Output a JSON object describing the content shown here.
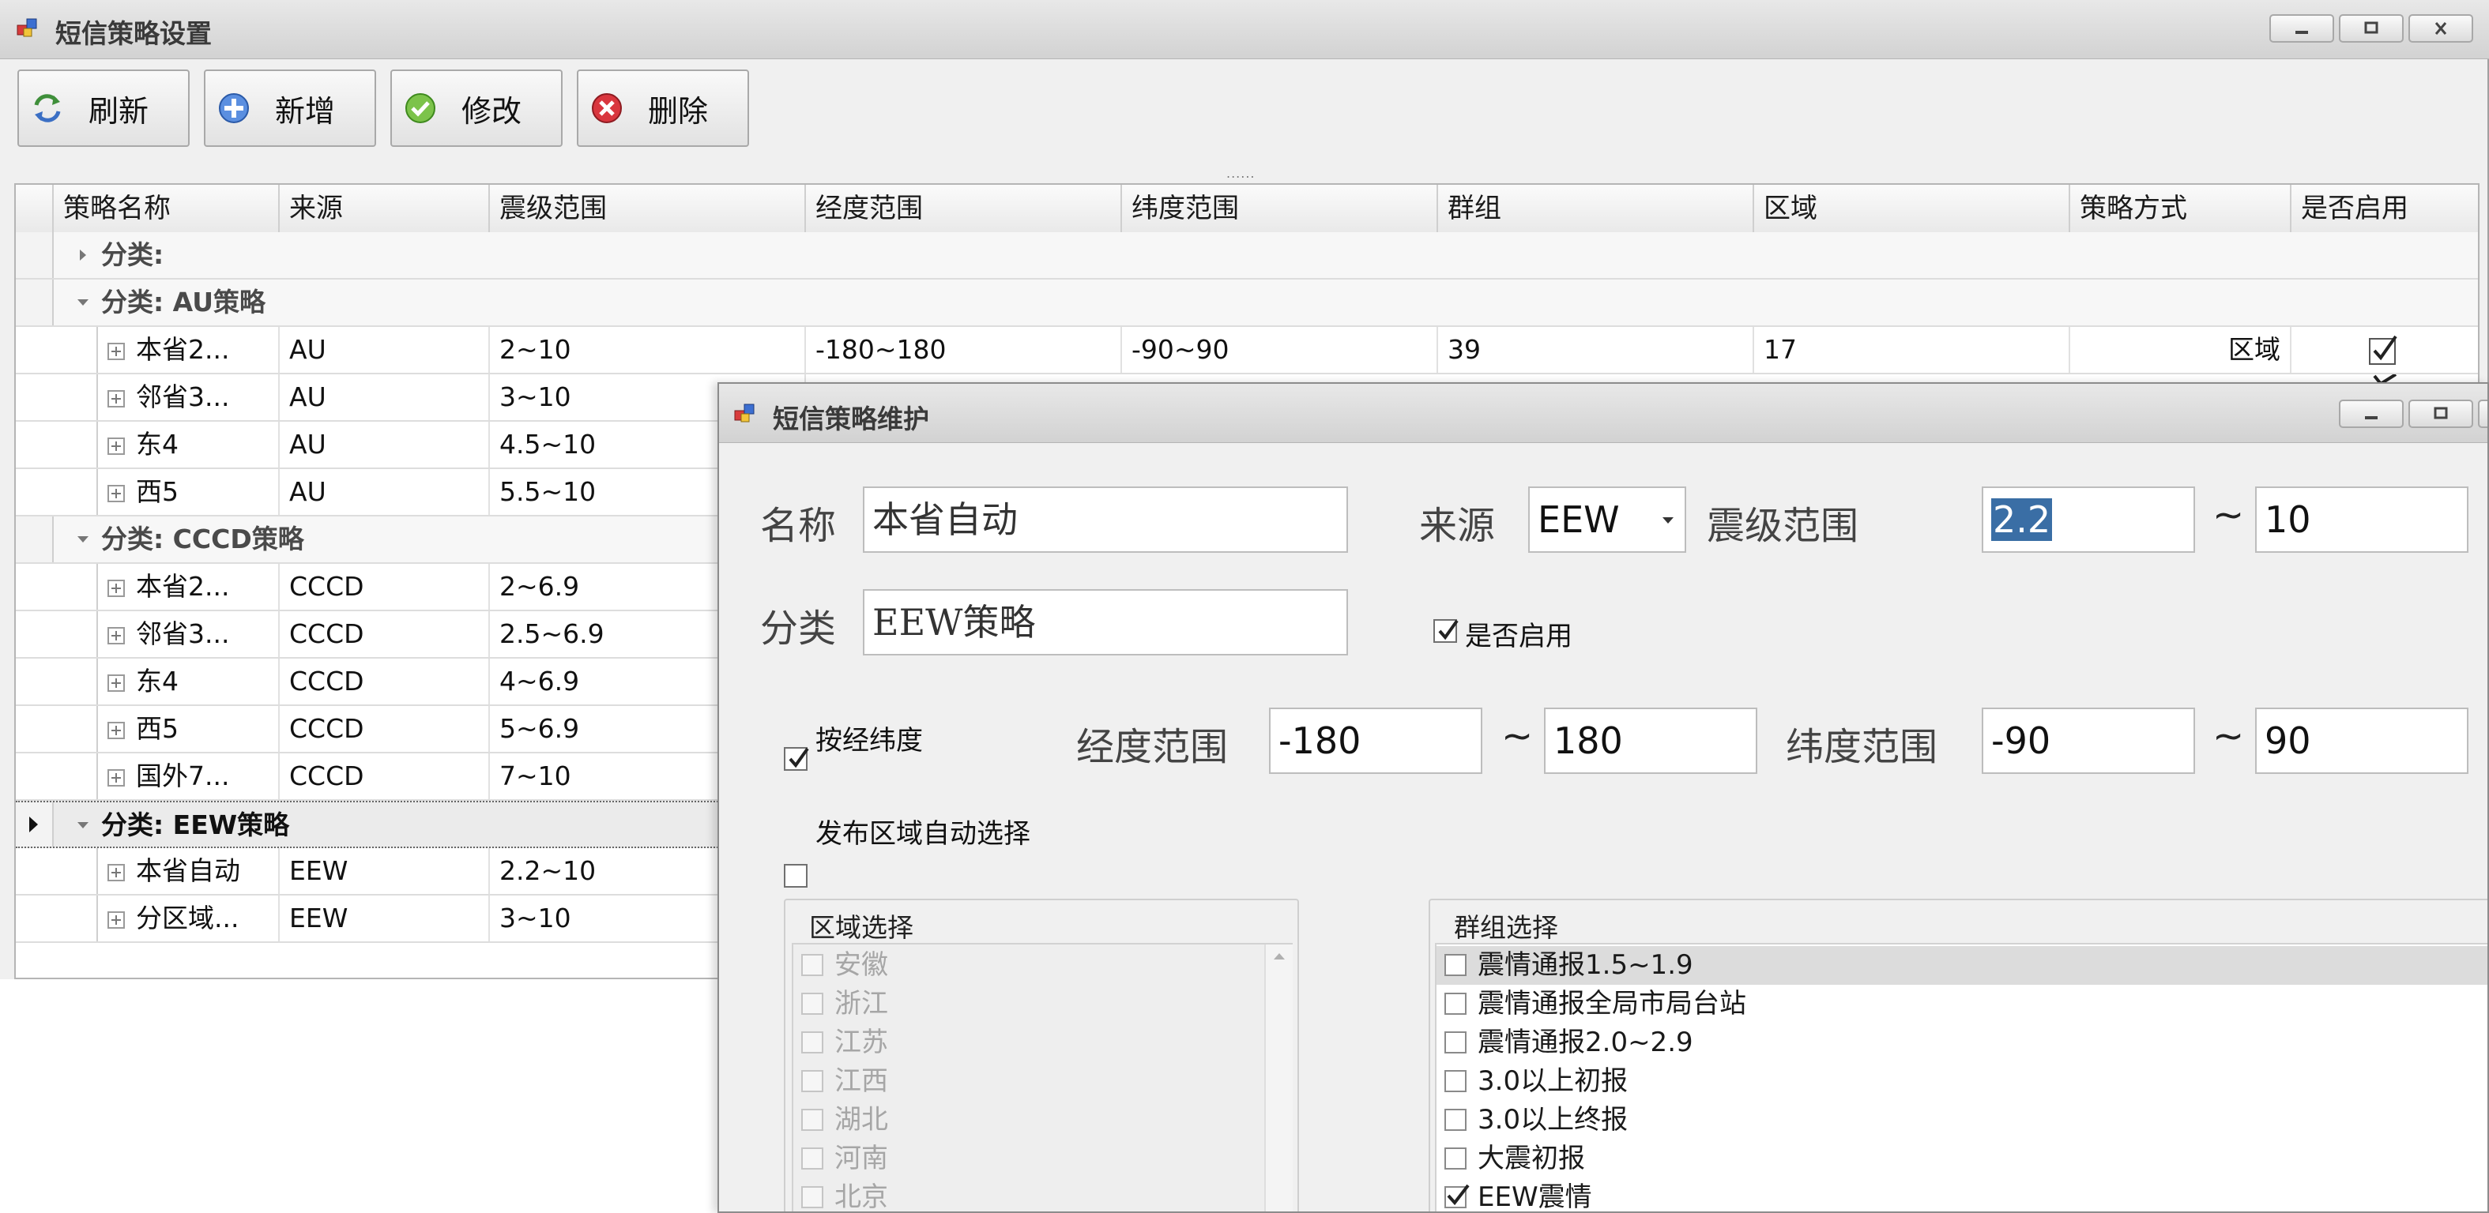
{
  "main": {
    "title": "短信策略设置",
    "toolbar": [
      {
        "label": "刷新",
        "icon": "refresh-icon"
      },
      {
        "label": "新增",
        "icon": "add-icon"
      },
      {
        "label": "修改",
        "icon": "edit-icon"
      },
      {
        "label": "删除",
        "icon": "delete-icon"
      }
    ],
    "splitter_grip": "......",
    "columns": [
      "策略名称",
      "来源",
      "震级范围",
      "经度范围",
      "纬度范围",
      "群组",
      "区域",
      "策略方式",
      "是否启用"
    ],
    "groups": [
      {
        "label": "分类:",
        "expanded": false,
        "rows": []
      },
      {
        "label": "分类: AU策略",
        "expanded": true,
        "rows": [
          {
            "name": "本省2...",
            "source": "AU",
            "magnitude": "2~10",
            "longitude": "-180~180",
            "latitude": "-90~90",
            "group": "39",
            "region": "17",
            "mode": "区域",
            "enabled": true
          },
          {
            "name": "邻省3...",
            "source": "AU",
            "magnitude": "3~10",
            "longitude": "",
            "latitude": "",
            "group": "",
            "region": "",
            "mode": "",
            "enabled": true
          },
          {
            "name": "东4",
            "source": "AU",
            "magnitude": "4.5~10"
          },
          {
            "name": "西5",
            "source": "AU",
            "magnitude": "5.5~10"
          }
        ]
      },
      {
        "label": "分类: CCCD策略",
        "expanded": true,
        "rows": [
          {
            "name": "本省2...",
            "source": "CCCD",
            "magnitude": "2~6.9"
          },
          {
            "name": "邻省3...",
            "source": "CCCD",
            "magnitude": "2.5~6.9"
          },
          {
            "name": "东4",
            "source": "CCCD",
            "magnitude": "4~6.9"
          },
          {
            "name": "西5",
            "source": "CCCD",
            "magnitude": "5~6.9"
          },
          {
            "name": "国外7...",
            "source": "CCCD",
            "magnitude": "7~10"
          }
        ]
      },
      {
        "label": "分类: EEW策略",
        "expanded": true,
        "selected": true,
        "rows": [
          {
            "name": "本省自动",
            "source": "EEW",
            "magnitude": "2.2~10"
          },
          {
            "name": "分区域...",
            "source": "EEW",
            "magnitude": "3~10"
          }
        ]
      }
    ]
  },
  "dialog": {
    "title": "短信策略维护",
    "name_label": "名称",
    "name_value": "本省自动",
    "source_label": "来源",
    "source_value": "EEW",
    "magnitude_label": "震级范围",
    "mag_min": "2.2",
    "mag_max": "10",
    "tilde": "~",
    "category_label": "分类",
    "category_value": "EEW策略",
    "enabled_label": "是否启用",
    "enabled_checked": true,
    "bylatlon_label": "按经纬度",
    "bylatlon_checked": true,
    "lon_label": "经度范围",
    "lon_min": "-180",
    "lon_max": "180",
    "lat_label": "纬度范围",
    "lat_min": "-90",
    "lat_max": "90",
    "auto_region_label": "发布区域自动选择",
    "auto_region_checked": false,
    "region_box_title": "区域选择",
    "regions": [
      "安徽",
      "浙江",
      "江苏",
      "江西",
      "湖北",
      "河南",
      "北京"
    ],
    "group_box_title": "群组选择",
    "groups": [
      {
        "label": "震情通报1.5~1.9",
        "checked": false
      },
      {
        "label": "震情通报全局市局台站",
        "checked": false
      },
      {
        "label": "震情通报2.0~2.9",
        "checked": false
      },
      {
        "label": "3.0以上初报",
        "checked": false
      },
      {
        "label": "3.0以上终报",
        "checked": false
      },
      {
        "label": "大震初报",
        "checked": false
      },
      {
        "label": "EEW震情",
        "checked": true
      }
    ]
  }
}
